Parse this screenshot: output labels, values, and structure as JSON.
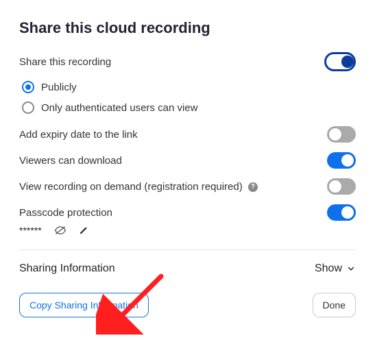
{
  "title": "Share this cloud recording",
  "shareRecording": {
    "label": "Share this recording",
    "enabled": true
  },
  "visibility": {
    "options": [
      {
        "id": "public",
        "label": "Publicly",
        "selected": true
      },
      {
        "id": "auth",
        "label": "Only authenticated users can view",
        "selected": false
      }
    ]
  },
  "expiry": {
    "label": "Add expiry date to the link",
    "enabled": false
  },
  "download": {
    "label": "Viewers can download",
    "enabled": true
  },
  "onDemand": {
    "label": "View recording on demand (registration required)",
    "enabled": false
  },
  "passcode": {
    "label": "Passcode protection",
    "enabled": true,
    "masked": "******"
  },
  "sharingInfo": {
    "heading": "Sharing Information",
    "toggleLabel": "Show"
  },
  "buttons": {
    "copy": "Copy Sharing Information",
    "done": "Done"
  },
  "colors": {
    "accent": "#0e71eb",
    "primaryToggle": "#0b3c9c",
    "arrow": "#ff1f1f"
  }
}
